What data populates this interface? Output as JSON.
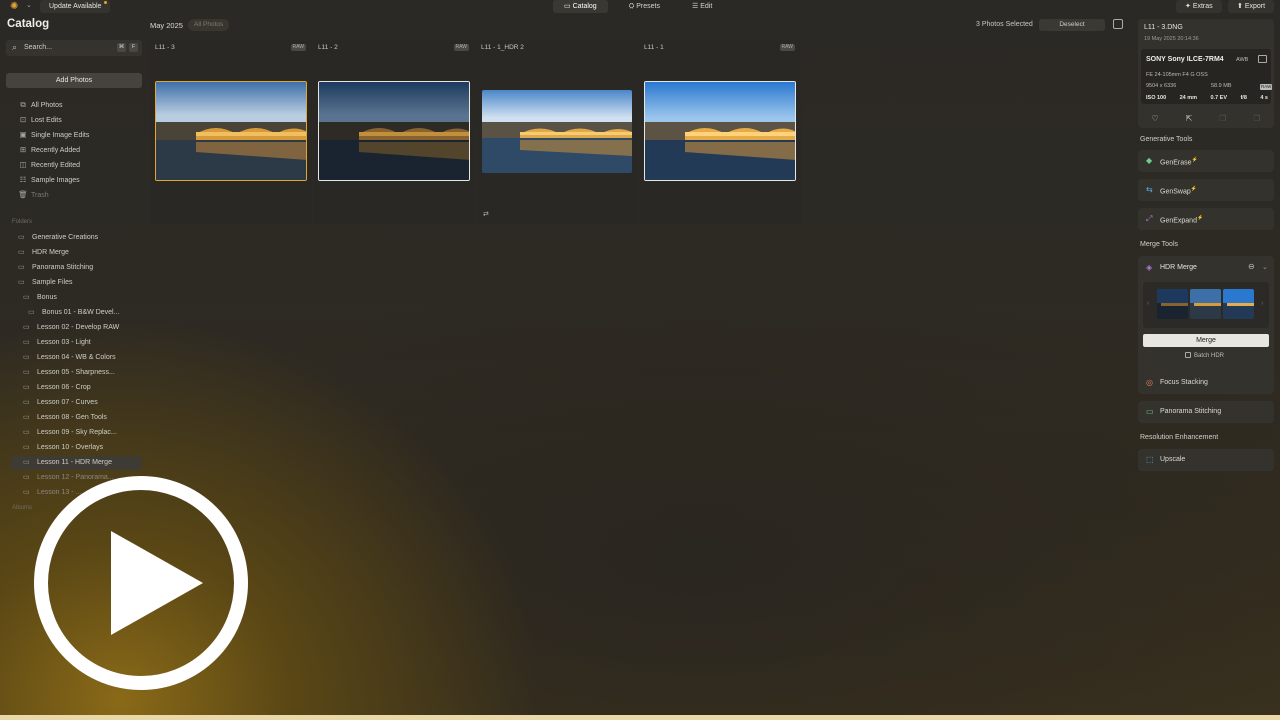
{
  "topbar": {
    "update": "Update Available",
    "tabs": [
      "Catalog",
      "Presets",
      "Edit"
    ],
    "tab_icons": [
      "folder-icon",
      "presets-icon",
      "sliders-icon"
    ],
    "extras": "Extras",
    "export": "Export"
  },
  "sidebar": {
    "title": "Catalog",
    "search_placeholder": "Search...",
    "search_keys": [
      "⌘",
      "F"
    ],
    "add_photos": "Add Photos",
    "nav": [
      {
        "label": "All Photos",
        "icon": "photos-icon"
      },
      {
        "label": "Lost Edits",
        "icon": "lost-edits-icon"
      },
      {
        "label": "Single Image Edits",
        "icon": "single-image-icon"
      },
      {
        "label": "Recently Added",
        "icon": "recently-added-icon"
      },
      {
        "label": "Recently Edited",
        "icon": "recently-edited-icon"
      },
      {
        "label": "Sample Images",
        "icon": "sample-images-icon"
      },
      {
        "label": "Trash",
        "icon": "trash-icon"
      }
    ],
    "folders_label": "Folders",
    "albums_label": "Albums",
    "folders": [
      "Generative Creations",
      "HDR Merge",
      "Panorama Stitching",
      "Sample Files",
      "Bonus",
      "Bonus 01 - B&W Devel...",
      "Lesson 02 - Develop RAW",
      "Lesson 03 - Light",
      "Lesson 04 - WB & Colors",
      "Lesson 05 - Sharpness...",
      "Lesson 06 - Crop",
      "Lesson 07 - Curves",
      "Lesson 08 - Gen Tools",
      "Lesson 09 - Sky Replac...",
      "Lesson 10 - Overlays",
      "Lesson 11 - HDR Merge",
      "Lesson 12 - Panorama...",
      "Lesson 13 - ..."
    ],
    "selected_folder": "Lesson 11 - HDR Merge"
  },
  "main": {
    "date": "May 2025",
    "filter": "All Photos",
    "selected_count": "3 Photos Selected",
    "deselect": "Deselect",
    "photos": [
      {
        "name": "L11 - 3",
        "badge": "RAW",
        "style": "dusk"
      },
      {
        "name": "L11 - 2",
        "badge": "RAW",
        "style": "dark"
      },
      {
        "name": "L11 - 1_HDR 2",
        "badge": "",
        "style": "hdr"
      },
      {
        "name": "L11 - 1",
        "badge": "RAW",
        "style": "bright"
      }
    ]
  },
  "info": {
    "filename": "L11 - 3.DNG",
    "datetime": "19 May 2025 20:14:36",
    "camera": "SONY Sony ILCE-7RM4",
    "wb": "AWB",
    "lens": "FE 24-105mm F4 G OSS",
    "dimensions": "9504 x 6336",
    "filesize": "58.9 MB",
    "format": "RAW",
    "exif": [
      "ISO 100",
      "24 mm",
      "0.7 EV",
      "f/8",
      "4 s"
    ]
  },
  "tools": {
    "generative_label": "Generative Tools",
    "generative": [
      "GenErase",
      "GenSwap",
      "GenExpand"
    ],
    "merge_label": "Merge Tools",
    "hdr_title": "HDR Merge",
    "merge_button": "Merge",
    "batch_label": "Batch HDR",
    "focus": "Focus Stacking",
    "panorama": "Panorama Stitching",
    "resolution_label": "Resolution Enhancement",
    "upscale": "Upscale"
  },
  "colors": {
    "accent": "#e0a92e",
    "gen_sparkle": "#6aa9e0"
  }
}
